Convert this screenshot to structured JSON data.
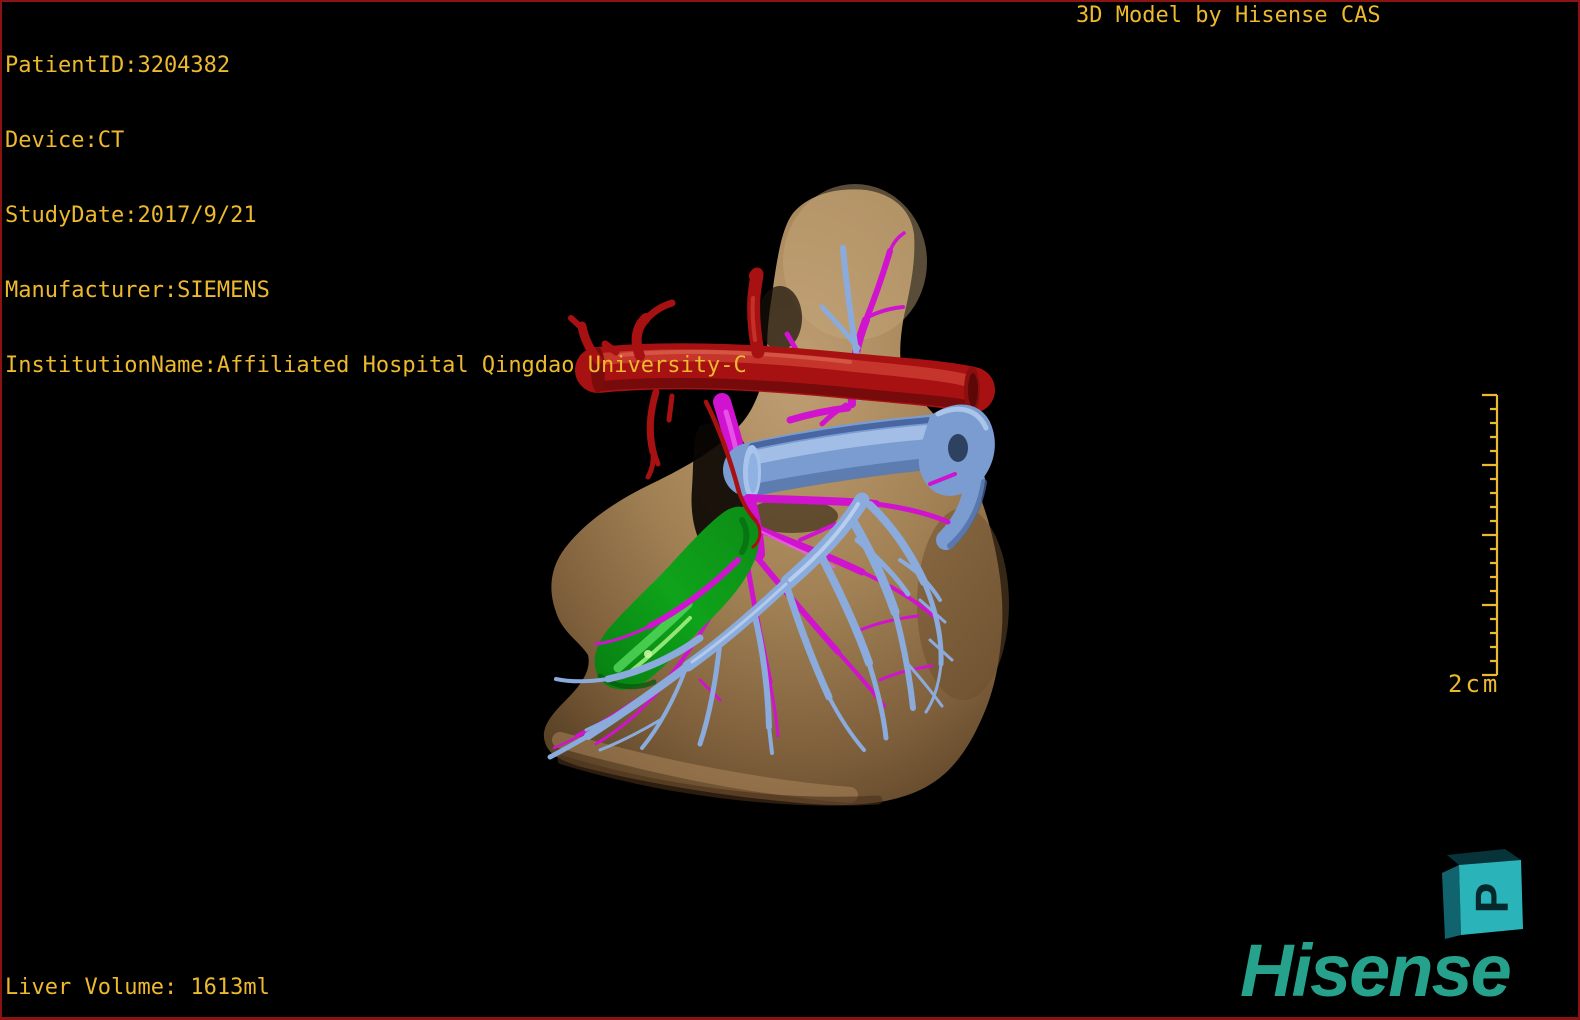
{
  "patient_info": {
    "lines": [
      "PatientID:3204382",
      "Device:CT",
      "StudyDate:2017/9/21",
      "Manufacturer:SIEMENS",
      "InstitutionName:Affiliated Hospital Qingdao University-C"
    ]
  },
  "header": {
    "title": "3D Model by Hisense CAS"
  },
  "measurements": {
    "liver_volume": "Liver Volume: 1613ml"
  },
  "scale_bar": {
    "label": "2cm"
  },
  "orientation_cube": {
    "letter": "P"
  },
  "branding": {
    "logo_text": "Hisense"
  },
  "colors": {
    "background": "#000000",
    "frame_border": "#8a1414",
    "overlay_text": "#edb92e",
    "brand_teal": "#26a28c",
    "cube_face": "#2ab4ba",
    "liver_tan": "#a98257",
    "hepatic_artery_red": "#a81111",
    "portal_vein_magenta": "#cf13cf",
    "hepatic_vein_blue": "#8aabdb",
    "ivc_blue": "#7b9cd1",
    "gallbladder_green": "#0fa31a"
  }
}
